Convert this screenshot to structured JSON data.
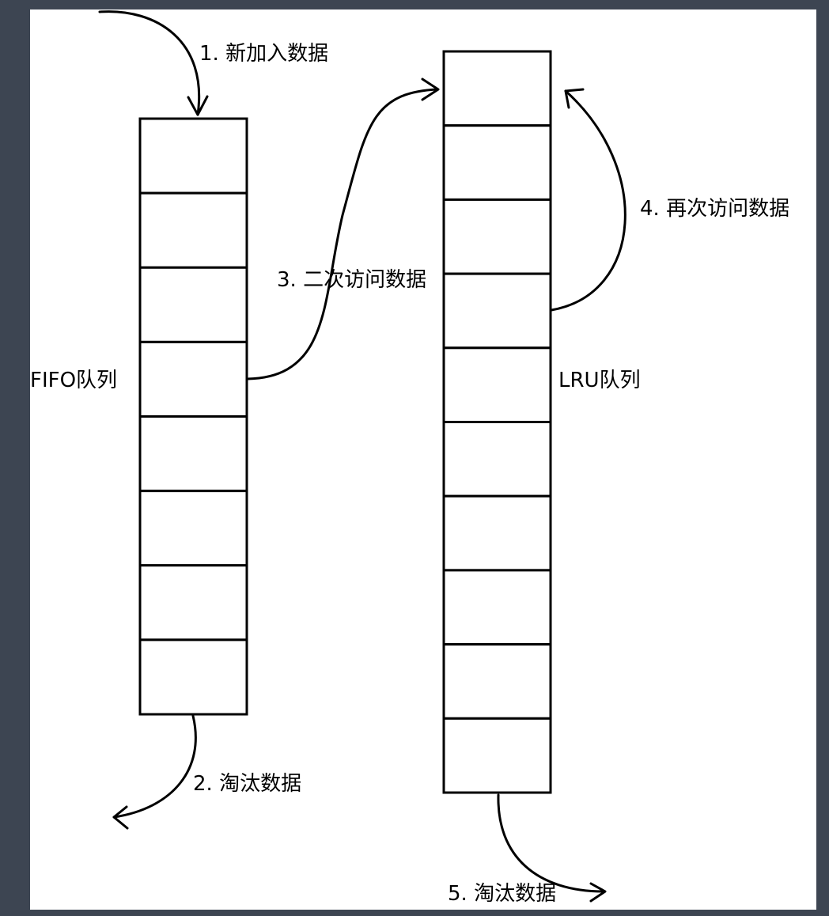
{
  "diagram": {
    "fifo_queue": {
      "label": "FIFO队列",
      "cell_count": 8
    },
    "lru_queue": {
      "label": "LRU队列",
      "cell_count": 10
    },
    "steps": {
      "step1": "1. 新加入数据",
      "step2": "2. 淘汰数据",
      "step3": "3. 二次访问数据",
      "step4": "4. 再次访问数据",
      "step5": "5. 淘汰数据"
    },
    "colors": {
      "background": "#3d4552",
      "canvas": "#ffffff",
      "stroke": "#000000"
    }
  }
}
